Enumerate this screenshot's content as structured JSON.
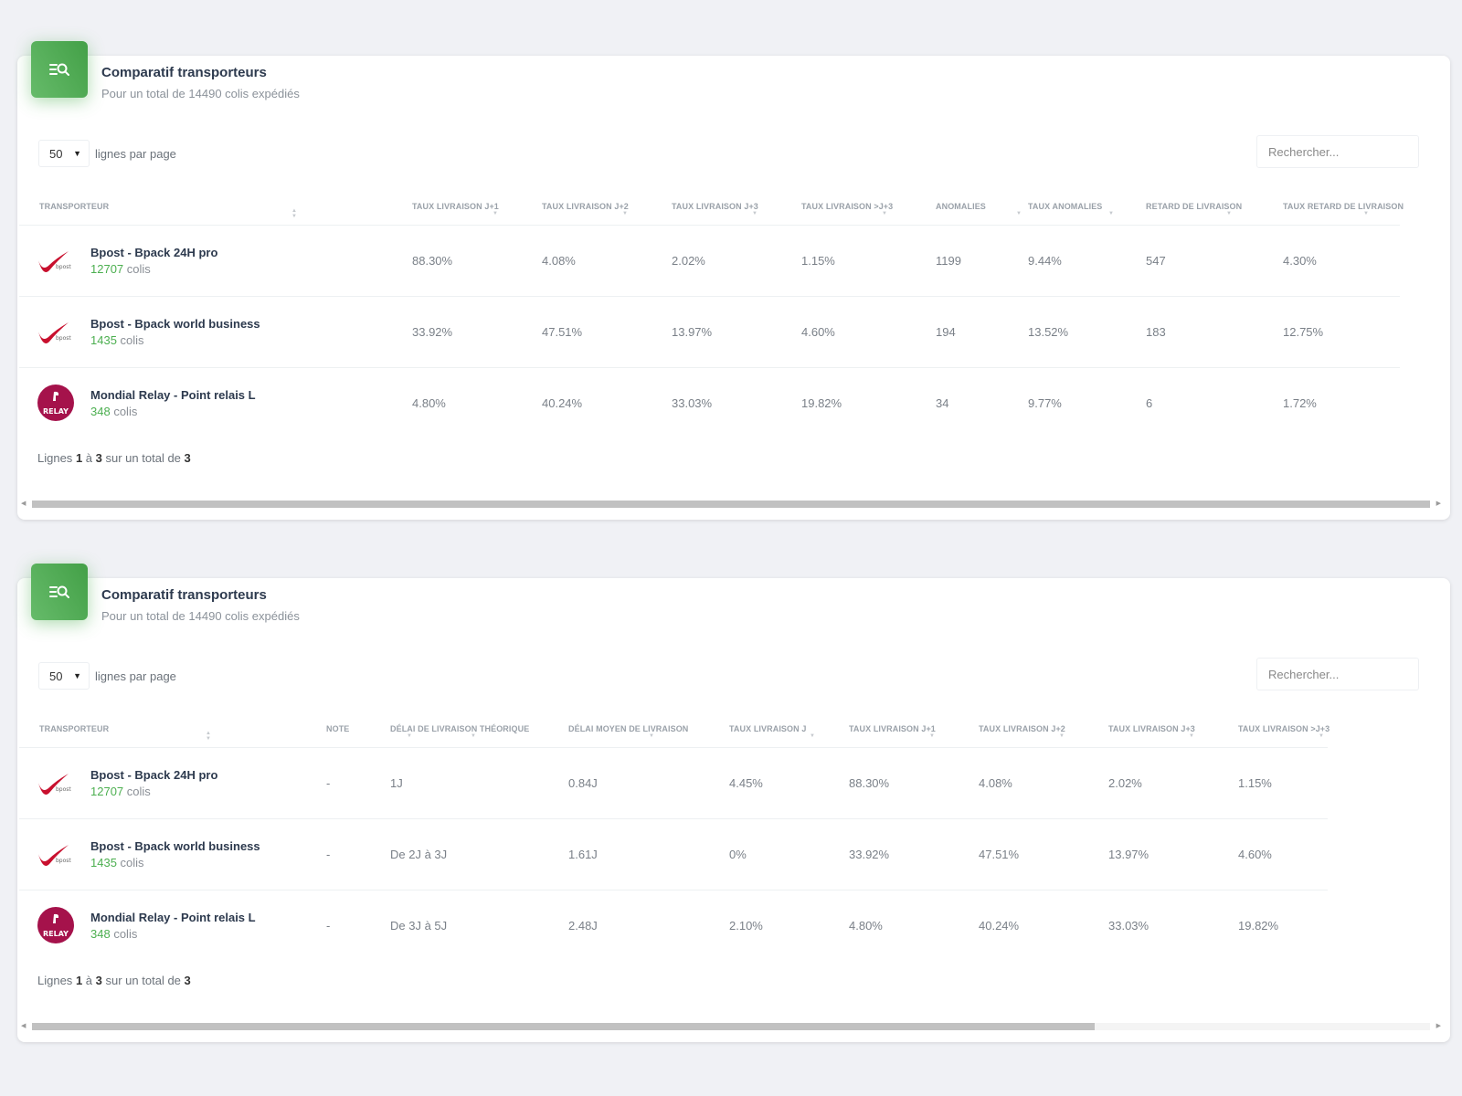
{
  "colors": {
    "accent_green": "#4caf50",
    "bpost_red": "#c8102e",
    "mondial_red": "#a5124b"
  },
  "icons": {
    "card_header": "list-search-icon",
    "bpost": "bpost-logo",
    "mondial": "mondial-relay-logo"
  },
  "cards": [
    {
      "title": "Comparatif transporteurs",
      "subtitle": "Pour un total de 14490 colis expédiés",
      "length_value": "50",
      "length_label": "lignes par page",
      "search_placeholder": "Rechercher...",
      "columns": [
        "Transporteur",
        "Taux livraison J+1",
        "Taux livraison J+2",
        "Taux livraison J+3",
        "Taux livraison >J+3",
        "Anomalies",
        "Taux anomalies",
        "Retard de livraison",
        "Taux retard de livraison"
      ],
      "rows": [
        {
          "name": "Bpost - Bpack 24H pro",
          "count": "12707",
          "unit": "colis",
          "values": [
            "88.30%",
            "4.08%",
            "2.02%",
            "1.15%",
            "1199",
            "9.44%",
            "547",
            "4.30%"
          ]
        },
        {
          "name": "Bpost - Bpack world business",
          "count": "1435",
          "unit": "colis",
          "values": [
            "33.92%",
            "47.51%",
            "13.97%",
            "4.60%",
            "194",
            "13.52%",
            "183",
            "12.75%"
          ]
        },
        {
          "name": "Mondial Relay - Point relais L",
          "count": "348",
          "unit": "colis",
          "values": [
            "4.80%",
            "40.24%",
            "33.03%",
            "19.82%",
            "34",
            "9.77%",
            "6",
            "1.72%"
          ]
        }
      ],
      "info": {
        "prefix": "Lignes",
        "start": "1",
        "sep": "à",
        "end": "3",
        "mid": "sur un total de",
        "total": "3"
      },
      "scroll_fraction": 1.0
    },
    {
      "title": "Comparatif transporteurs",
      "subtitle": "Pour un total de 14490 colis expédiés",
      "length_value": "50",
      "length_label": "lignes par page",
      "search_placeholder": "Rechercher...",
      "columns": [
        "Transporteur",
        "Note",
        "Délai de livraison théorique",
        "Délai moyen de livraison",
        "Taux livraison J",
        "Taux livraison J+1",
        "Taux livraison J+2",
        "Taux livraison J+3",
        "Taux livraison >J+3"
      ],
      "rows": [
        {
          "name": "Bpost - Bpack 24H pro",
          "count": "12707",
          "unit": "colis",
          "values": [
            "-",
            "1J",
            "0.84J",
            "4.45%",
            "88.30%",
            "4.08%",
            "2.02%",
            "1.15%"
          ]
        },
        {
          "name": "Bpost - Bpack world business",
          "count": "1435",
          "unit": "colis",
          "values": [
            "-",
            "De 2J à 3J",
            "1.61J",
            "0%",
            "33.92%",
            "47.51%",
            "13.97%",
            "4.60%"
          ]
        },
        {
          "name": "Mondial Relay - Point relais L",
          "count": "348",
          "unit": "colis",
          "values": [
            "-",
            "De 3J à 5J",
            "2.48J",
            "2.10%",
            "4.80%",
            "40.24%",
            "33.03%",
            "19.82%"
          ]
        }
      ],
      "info": {
        "prefix": "Lignes",
        "start": "1",
        "sep": "à",
        "end": "3",
        "mid": "sur un total de",
        "total": "3"
      },
      "scroll_fraction": 0.76
    }
  ]
}
